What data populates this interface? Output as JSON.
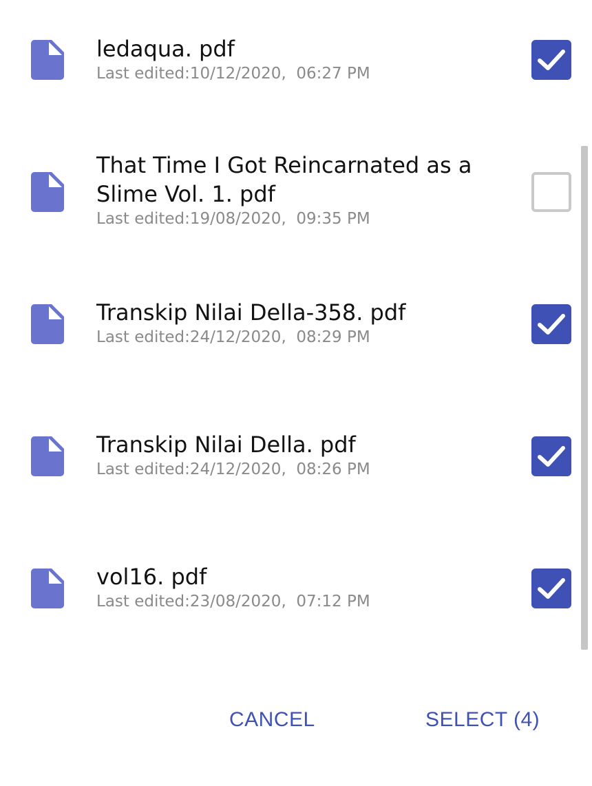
{
  "files": [
    {
      "name": "ledaqua. pdf",
      "meta": "Last edited:10/12/2020,  06:27 PM",
      "checked": true
    },
    {
      "name": "That Time I Got Reincarnated as a Slime  Vol.  1. pdf",
      "meta": "Last edited:19/08/2020,  09:35 PM",
      "checked": false
    },
    {
      "name": "Transkip Nilai Della-358. pdf",
      "meta": "Last edited:24/12/2020,  08:29 PM",
      "checked": true
    },
    {
      "name": "Transkip Nilai Della. pdf",
      "meta": "Last edited:24/12/2020,  08:26 PM",
      "checked": true
    },
    {
      "name": "vol16. pdf",
      "meta": "Last edited:23/08/2020,  07:12 PM",
      "checked": true
    }
  ],
  "actions": {
    "cancel_label": "CANCEL",
    "select_label": "SELECT (4)"
  },
  "colors": {
    "accent": "#3f51b5",
    "file_icon": "#6a74cf",
    "unchecked_border": "#c9c9c9",
    "meta_text": "#8a8a8a"
  },
  "icons": {
    "file": "file-document-icon",
    "check": "check-icon"
  }
}
